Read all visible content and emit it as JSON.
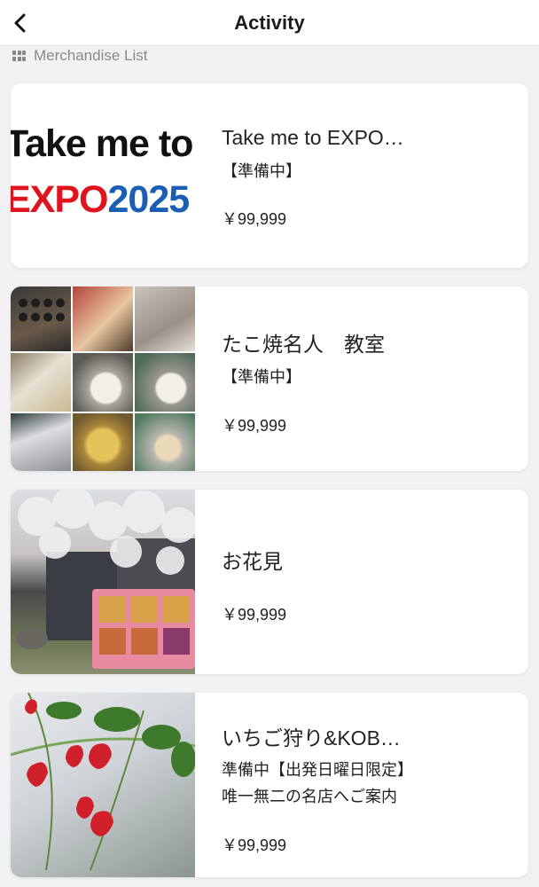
{
  "header": {
    "title": "Activity",
    "back_icon": "chevron-left-icon"
  },
  "section": {
    "label": "Merchandise List",
    "icon": "grid-icon"
  },
  "items": [
    {
      "title": "Take me to EXPO…",
      "status": "【準備中】",
      "price": "￥99,999",
      "thumb_text_1": "Take me to",
      "thumb_text_2a": "EXPO",
      "thumb_text_2b": "2025"
    },
    {
      "title": "たこ焼名人　教室",
      "status": "【準備中】",
      "price": "￥99,999"
    },
    {
      "title": "お花見",
      "price": "￥99,999"
    },
    {
      "title": "いちご狩り&KOB…",
      "desc_line1": "準備中【出発日曜日限定】",
      "desc_line2": "唯一無二の名店へご案内",
      "price": "￥99,999"
    }
  ],
  "colors": {
    "background": "#f2f2f4",
    "card": "#ffffff",
    "expo_red": "#e0141e",
    "expo_blue": "#1a5fb4"
  }
}
